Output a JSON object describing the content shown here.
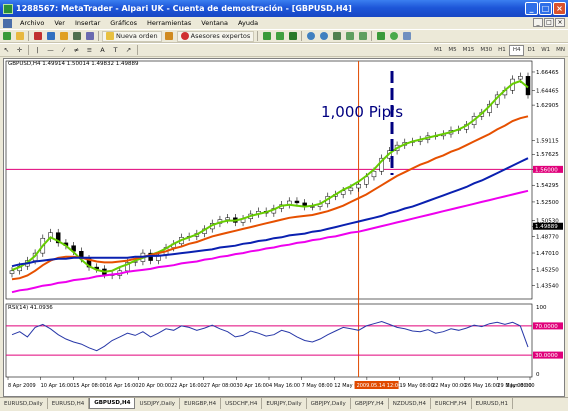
{
  "window": {
    "title": "1288567: MetaTrader - Alpari UK - Cuenta de demostración - [GBPUSD,H4]",
    "controls": [
      "_",
      "□",
      "×"
    ]
  },
  "menu": {
    "items": [
      "Archivo",
      "Ver",
      "Insertar",
      "Gráficos",
      "Herramientas",
      "Ventana",
      "Ayuda"
    ],
    "mdi_controls": [
      "_",
      "□",
      "×"
    ]
  },
  "toolbar": {
    "new_order_label": "Nueva orden",
    "expert_advisors_label": "Asesores expertos",
    "text_tool_label": "A",
    "timeframes": [
      "M1",
      "M5",
      "M15",
      "M30",
      "H1",
      "H4",
      "D1",
      "W1",
      "MN"
    ],
    "active_timeframe": "H4"
  },
  "chart": {
    "header": "GBPUSD,H4  1.49914 1.50014 1.49832 1.49889",
    "annotation": "1,000 Pip's",
    "rsi_header": "RSI(14) 41.0936",
    "colors": {
      "price": "#000000",
      "ma_fast": "#66cc00",
      "ma_mid": "#e65000",
      "ma_slow": "#0a20b0",
      "ma_long": "#ee00ee",
      "hline": "#e0007a",
      "vline": "#e04a00",
      "annotation": "#000080",
      "rsi": "#2838a8"
    }
  },
  "chart_data": {
    "type": "line",
    "symbol": "GBPUSD",
    "timeframe": "H4",
    "y_ticks": [
      "1.66465",
      "1.64465",
      "1.62905",
      "1.59115",
      "1.57625",
      "1.56000",
      "1.54295",
      "1.52500",
      "1.50530",
      "1.49889",
      "1.48770",
      "1.47010",
      "1.45250",
      "1.43540"
    ],
    "ylim": [
      1.425,
      1.67
    ],
    "horizontal_line": 1.56,
    "current_price": 1.49889,
    "x_ticks": [
      "8 Apr 2009",
      "10 Apr 16:00",
      "15 Apr 08:00",
      "16 Apr 16:00",
      "20 Apr 00:00",
      "22 Apr 16:00",
      "27 Apr 08:00",
      "30 Apr 16:00",
      "4 May 16:00",
      "7 May 08:00",
      "12 May 00:00",
      "14 May 16:00",
      "19 May 08:00",
      "22 May 00:00",
      "26 May 16:00",
      "29 May 08:00",
      "3 Jun 00:00"
    ],
    "cursor_label": "2009.05.14 12:00",
    "series": [
      {
        "name": "price",
        "values": [
          1.451,
          1.456,
          1.462,
          1.47,
          1.486,
          1.492,
          1.481,
          1.478,
          1.472,
          1.464,
          1.455,
          1.453,
          1.447,
          1.446,
          1.451,
          1.46,
          1.461,
          1.47,
          1.462,
          1.468,
          1.476,
          1.48,
          1.487,
          1.488,
          1.491,
          1.496,
          1.502,
          1.506,
          1.508,
          1.503,
          1.507,
          1.512,
          1.515,
          1.513,
          1.518,
          1.522,
          1.526,
          1.524,
          1.52,
          1.52,
          1.523,
          1.531,
          1.533,
          1.537,
          1.54,
          1.544,
          1.552,
          1.558,
          1.572,
          1.58,
          1.586,
          1.589,
          1.59,
          1.592,
          1.596,
          1.596,
          1.598,
          1.602,
          1.603,
          1.608,
          1.617,
          1.621,
          1.63,
          1.64,
          1.645,
          1.657,
          1.66,
          1.64
        ]
      },
      {
        "name": "ma_fast",
        "values": [
          1.452,
          1.455,
          1.46,
          1.467,
          1.478,
          1.487,
          1.483,
          1.478,
          1.471,
          1.463,
          1.456,
          1.452,
          1.45,
          1.451,
          1.455,
          1.458,
          1.462,
          1.465,
          1.468,
          1.471,
          1.475,
          1.48,
          1.484,
          1.487,
          1.49,
          1.495,
          1.5,
          1.503,
          1.505,
          1.505,
          1.507,
          1.51,
          1.512,
          1.514,
          1.517,
          1.521,
          1.522,
          1.521,
          1.52,
          1.521,
          1.523,
          1.528,
          1.533,
          1.538,
          1.542,
          1.547,
          1.553,
          1.56,
          1.569,
          1.577,
          1.583,
          1.587,
          1.59,
          1.592,
          1.594,
          1.596,
          1.598,
          1.6,
          1.603,
          1.607,
          1.613,
          1.62,
          1.628,
          1.637,
          1.645,
          1.652,
          1.655,
          1.648
        ]
      },
      {
        "name": "ma_mid",
        "values": [
          1.442,
          1.443,
          1.446,
          1.451,
          1.457,
          1.462,
          1.465,
          1.466,
          1.466,
          1.465,
          1.463,
          1.461,
          1.46,
          1.46,
          1.461,
          1.462,
          1.464,
          1.466,
          1.468,
          1.47,
          1.472,
          1.475,
          1.477,
          1.48,
          1.482,
          1.485,
          1.488,
          1.49,
          1.492,
          1.494,
          1.496,
          1.498,
          1.5,
          1.502,
          1.504,
          1.506,
          1.508,
          1.509,
          1.51,
          1.511,
          1.513,
          1.515,
          1.518,
          1.521,
          1.525,
          1.529,
          1.533,
          1.538,
          1.543,
          1.548,
          1.553,
          1.557,
          1.561,
          1.565,
          1.568,
          1.572,
          1.575,
          1.579,
          1.582,
          1.586,
          1.59,
          1.594,
          1.598,
          1.603,
          1.607,
          1.612,
          1.615,
          1.617
        ]
      },
      {
        "name": "ma_slow",
        "values": [
          1.456,
          1.458,
          1.459,
          1.461,
          1.462,
          1.463,
          1.464,
          1.464,
          1.465,
          1.465,
          1.465,
          1.465,
          1.465,
          1.465,
          1.465,
          1.465,
          1.466,
          1.466,
          1.467,
          1.467,
          1.468,
          1.469,
          1.47,
          1.471,
          1.472,
          1.473,
          1.474,
          1.476,
          1.477,
          1.478,
          1.48,
          1.481,
          1.483,
          1.484,
          1.486,
          1.487,
          1.489,
          1.49,
          1.491,
          1.493,
          1.494,
          1.496,
          1.498,
          1.5,
          1.502,
          1.504,
          1.506,
          1.508,
          1.51,
          1.513,
          1.515,
          1.518,
          1.52,
          1.523,
          1.526,
          1.529,
          1.532,
          1.535,
          1.538,
          1.541,
          1.545,
          1.548,
          1.552,
          1.556,
          1.56,
          1.564,
          1.568,
          1.572
        ]
      },
      {
        "name": "ma_long",
        "values": [
          1.428,
          1.43,
          1.431,
          1.433,
          1.435,
          1.436,
          1.438,
          1.439,
          1.441,
          1.442,
          1.443,
          1.445,
          1.446,
          1.447,
          1.448,
          1.45,
          1.451,
          1.452,
          1.453,
          1.455,
          1.456,
          1.457,
          1.459,
          1.46,
          1.461,
          1.463,
          1.464,
          1.466,
          1.467,
          1.469,
          1.47,
          1.472,
          1.473,
          1.475,
          1.476,
          1.478,
          1.479,
          1.481,
          1.482,
          1.484,
          1.485,
          1.487,
          1.488,
          1.49,
          1.492,
          1.493,
          1.495,
          1.497,
          1.499,
          1.501,
          1.503,
          1.505,
          1.507,
          1.509,
          1.511,
          1.513,
          1.515,
          1.517,
          1.519,
          1.521,
          1.523,
          1.525,
          1.527,
          1.529,
          1.531,
          1.533,
          1.535,
          1.537
        ]
      }
    ],
    "rsi": {
      "ylim": [
        0,
        100
      ],
      "ticks": [
        "100",
        "70.0000",
        "30.0000",
        "0"
      ],
      "levels": [
        70,
        30
      ],
      "values": [
        58,
        62,
        55,
        68,
        72,
        66,
        58,
        52,
        48,
        45,
        40,
        36,
        42,
        50,
        55,
        60,
        57,
        62,
        55,
        60,
        66,
        64,
        70,
        68,
        64,
        67,
        71,
        66,
        62,
        55,
        57,
        63,
        60,
        56,
        58,
        64,
        61,
        55,
        50,
        48,
        52,
        58,
        63,
        68,
        66,
        64,
        70,
        73,
        76,
        72,
        68,
        66,
        63,
        62,
        65,
        60,
        62,
        66,
        64,
        67,
        71,
        69,
        73,
        75,
        72,
        75,
        70,
        41
      ]
    }
  },
  "tabs": {
    "items": [
      "EURUSD,Daily",
      "EURUSD,H4",
      "GBPUSD,H4",
      "USDJPY,Daily",
      "EURGBP,H4",
      "USDCHF,H4",
      "EURJPY,Daily",
      "GBPJPY,Daily",
      "GBPJPY,H4",
      "NZDUSD,H4",
      "EURCHF,H4",
      "EURUSD,H1"
    ],
    "active": "GBPUSD,H4"
  }
}
